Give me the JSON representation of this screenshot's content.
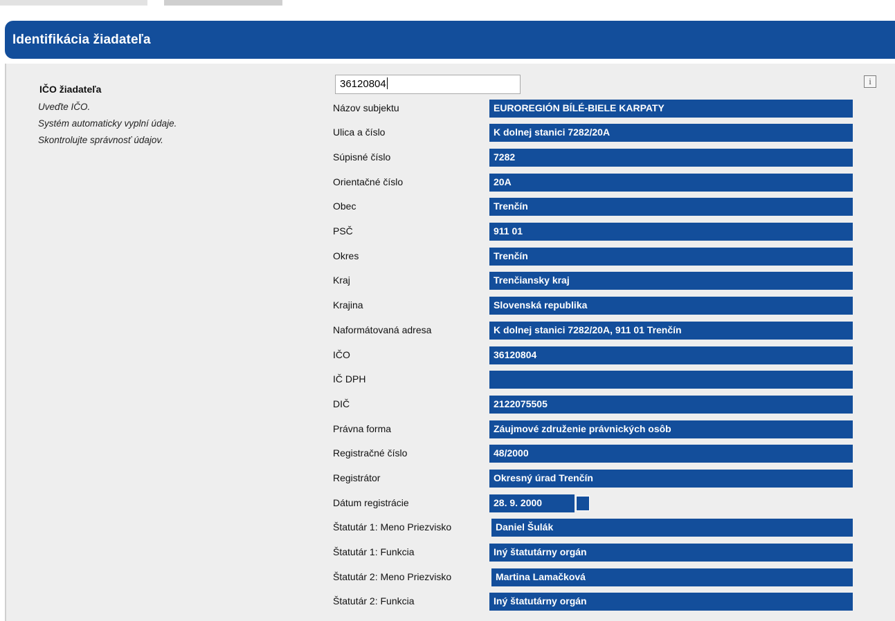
{
  "panel": {
    "title": "Identifikácia žiadateľa"
  },
  "applicant": {
    "ico_label": "IČO žiadateľa",
    "ico_value": "36120804",
    "hints": [
      "Uveďte IČO.",
      "Systém automaticky vyplní údaje.",
      "Skontrolujte správnosť údajov."
    ],
    "info_icon": "i"
  },
  "fields": [
    {
      "label": "Názov subjektu",
      "value": "EUROREGIÓN BÍLÉ-BIELE KARPATY"
    },
    {
      "label": "Ulica a číslo",
      "value": "K dolnej stanici 7282/20A"
    },
    {
      "label": "Súpisné číslo",
      "value": "7282"
    },
    {
      "label": "Orientačné číslo",
      "value": "20A"
    },
    {
      "label": "Obec",
      "value": "Trenčín"
    },
    {
      "label": "PSČ",
      "value": "911 01"
    },
    {
      "label": "Okres",
      "value": "Trenčín"
    },
    {
      "label": "Kraj",
      "value": "Trenčiansky kraj"
    },
    {
      "label": "Krajina",
      "value": "Slovenská republika"
    },
    {
      "label": "Naformátovaná adresa",
      "value": "K dolnej stanici 7282/20A, 911 01 Trenčín"
    },
    {
      "label": "IČO",
      "value": "36120804"
    },
    {
      "label": "IČ DPH",
      "value": ""
    },
    {
      "label": "DIČ",
      "value": "2122075505"
    },
    {
      "label": "Právna forma",
      "value": "Záujmové združenie právnických osôb"
    },
    {
      "label": "Registračné číslo",
      "value": "48/2000"
    },
    {
      "label": "Registrátor",
      "value": "Okresný úrad Trenčín"
    },
    {
      "label": "Dátum registrácie",
      "value": "28. 9. 2000"
    },
    {
      "label": "Štatutár 1: Meno Priezvisko",
      "value": "Daniel Šulák"
    },
    {
      "label": "Štatutár 1: Funkcia",
      "value": "Iný štatutárny orgán"
    },
    {
      "label": "Štatutár 2: Meno Priezvisko",
      "value": "Martina Lamačková"
    },
    {
      "label": "Štatutár 2: Funkcia",
      "value": "Iný štatutárny orgán"
    }
  ],
  "colors": {
    "header_blue": "#134e9b",
    "panel_bg": "#eeeeee"
  }
}
